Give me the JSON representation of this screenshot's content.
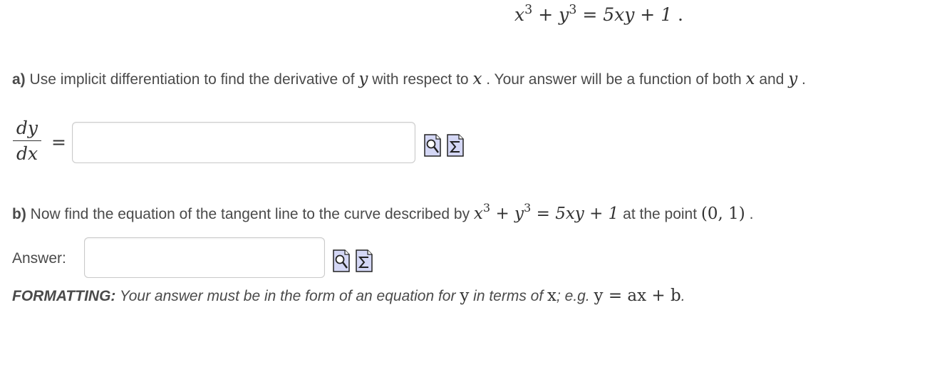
{
  "equation": {
    "x": "x",
    "exp1": "3",
    "plus": "+",
    "y": "y",
    "exp2": "3",
    "equals": "=",
    "rhs": "5xy + 1",
    "period": " ."
  },
  "part_a": {
    "label": "a)",
    "text1": " Use implicit differentiation to find the derivative of ",
    "var_y": "y",
    "text2": " with respect to ",
    "var_x": "x",
    "text3": " . Your answer will be a function of both ",
    "var_x2": "x",
    "text4": " and ",
    "var_y2": "y",
    "text5": " .",
    "frac_num": "dy",
    "frac_den": "dx",
    "equals": "="
  },
  "part_b": {
    "label": "b)",
    "text1": " Now find the equation of the tangent line to the curve described by ",
    "eq_x": "x",
    "eq_exp1": "3",
    "eq_plus": " + ",
    "eq_y": "y",
    "eq_exp2": "3",
    "eq_rest": " = 5xy + 1",
    "text2": " at the point ",
    "point": "(0, 1)",
    "text3": " ."
  },
  "answer_label": "Answer:",
  "formatting": {
    "label": "FORMATTING:",
    "text1": " Your answer must be in the form of an equation for ",
    "var_y": "y",
    "text2": " in terms of ",
    "var_x": "x",
    "text3": "; e.g. ",
    "example": "y = ax + b",
    "text4": "."
  },
  "icons": {
    "preview": "magnifier-preview-icon",
    "equation": "sigma-equation-editor-icon"
  }
}
